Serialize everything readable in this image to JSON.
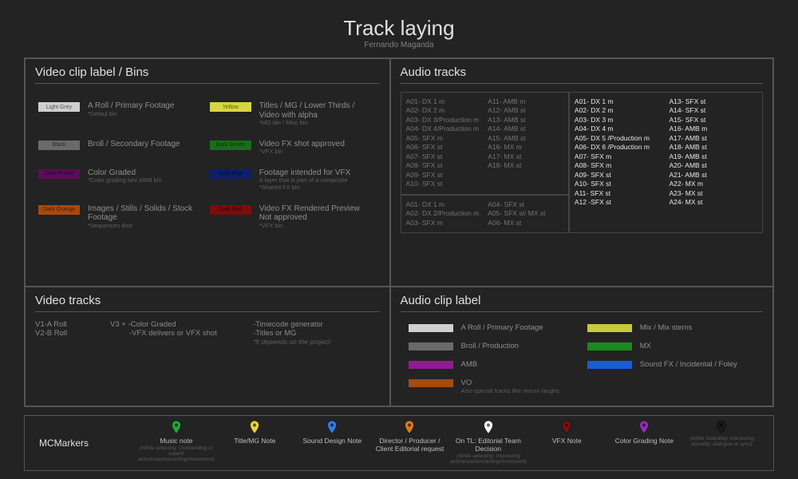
{
  "title": "Track laying",
  "subtitle": "Fernando Maganda",
  "video_clip_label": {
    "title": "Video clip label / Bins",
    "items": [
      {
        "swatch": "#cfcfcf",
        "swatch_label": "Light Grey",
        "label": "A Roll / Primary Footage",
        "note": "*Defaul bin"
      },
      {
        "swatch": "#d6d641",
        "swatch_label": "Yellow",
        "label": "Titles / MG / Lower Thirds / Video with alpha",
        "note": "*MG bin / Misc bin"
      },
      {
        "swatch": "#6a6a6a",
        "swatch_label": "Black",
        "label": "Broll / Secondary Footage",
        "note": ""
      },
      {
        "swatch": "#1c6b1c",
        "swatch_label": "Dark Green",
        "label": "Video FX shot approved",
        "note": "*VFX bin"
      },
      {
        "swatch": "#5a0d5a",
        "swatch_label": "Dark Purple",
        "label": "Color Graded",
        "note": "*Color grading bin/ AWB bin"
      },
      {
        "swatch": "#0d1e6b",
        "swatch_label": "Dark Blue",
        "label": "Footage intended for VFX",
        "note": "A layer that is part of a composite\n*Shared FX bin"
      },
      {
        "swatch": "#a64a0d",
        "swatch_label": "Dark Orange",
        "label": "Images / Stills / Solids / Stock Footage",
        "note": "*Sequences bins"
      },
      {
        "swatch": "#7a0d0d",
        "swatch_label": "Dark Red",
        "label": "Video FX Rendered Preview\nNot approved",
        "note": "*VFX bin"
      }
    ]
  },
  "video_tracks": {
    "title": "Video tracks",
    "col1": [
      "V1-A Roll",
      "V2-B Roll"
    ],
    "col2": [
      "V3 + -Color Graded",
      "-VFX delivers or VFX shot"
    ],
    "col3": [
      "-Timecode generator",
      "-Titles or MG",
      "*It depends on the project"
    ]
  },
  "audio_tracks": {
    "title": "Audio tracks",
    "panel_a": {
      "left": [
        "A01- DX 1 m",
        "A02- DX 2 m",
        "A03- DX 3/Production m",
        "A04- DX 4/Production m",
        "A05- SFX m",
        "A06- SFX st",
        "A07- SFX st",
        "A08- SFX st",
        "A09- SFX st",
        "A10- SFX st"
      ],
      "right": [
        "A11- AMB m",
        "A12- AMB st",
        "A13- AMB st",
        "A14- AMB st",
        "A15- AMB st",
        "A16- MX m",
        "A17- MX st",
        "A18- MX st"
      ]
    },
    "panel_b": {
      "left": [
        "A01- DX 1 m",
        "A02- DX 2/Production m",
        "A03- SFX m"
      ],
      "right": [
        "A04- SFX st",
        "A05- SFX st/ MX st",
        "A06- MX st"
      ]
    },
    "panel_c": {
      "left": [
        "A01- DX 1 m",
        "A02- DX 2 m",
        "A03- DX 3 m",
        "A04- DX 4 m",
        "A05- DX 5 /Production m",
        "A06- DX 6 /Production m",
        "A07- SFX m",
        "A08- SFX m",
        "A09- SFX st",
        "A10- SFX st",
        "A11- SFX st",
        "A12 -SFX st"
      ],
      "right": [
        "A13- SFX st",
        "A14- SFX st",
        "A15- SFX st",
        "A16- AMB m",
        "A17- AMB st",
        "A18- AMB st",
        "A19- AMB st",
        "A20- AMB st",
        "A21- AMB st",
        "A22- MX m",
        "A23- MX st",
        "A24- MX st"
      ]
    }
  },
  "audio_clip_label": {
    "title": "Audio clip label",
    "items": [
      {
        "swatch": "#cfcfcf",
        "label": "A Roll / Primary Footage",
        "note": ""
      },
      {
        "swatch": "#c9c93a",
        "label": "Mix / Mix stems",
        "note": ""
      },
      {
        "swatch": "#6a6a6a",
        "label": "Broll / Production",
        "note": ""
      },
      {
        "swatch": "#1c8a1c",
        "label": "MX",
        "note": ""
      },
      {
        "swatch": "#8f1c8f",
        "label": "AMB",
        "note": ""
      },
      {
        "swatch": "#1c5bd6",
        "label": "Sound FX / Incidental / Foley",
        "note": ""
      },
      {
        "swatch": "#a64a0d",
        "label": "VO",
        "note": "Also special tracks like vincon laughs"
      }
    ]
  },
  "mcmarkers": {
    "title": "MCMarkers",
    "items": [
      {
        "color": "#1fa83a",
        "label": "Music note",
        "note": "(While selecting: Outstanding or superb action/reaction/acting/movement)"
      },
      {
        "color": "#e9d23a",
        "label": "Title/MG Note",
        "note": ""
      },
      {
        "color": "#2f7de0",
        "label": "Sound Design Note",
        "note": ""
      },
      {
        "color": "#d97a1f",
        "label": "Director / Producer / Client Editorial request",
        "note": ""
      },
      {
        "color": "#f5f5f5",
        "label": "On TL: Editorial Team Decision",
        "note": "(While selecting: Interesting action/reaction/acting/movement)"
      },
      {
        "color": "#7a1212",
        "label": "VFX Note",
        "note": ""
      },
      {
        "color": "#8d2fb3",
        "label": "Color Grading Note",
        "note": ""
      },
      {
        "color": "#1a1a1a",
        "label": "",
        "note": "(While Selecting: Interesting actuality, dialogue or sync)"
      }
    ]
  }
}
